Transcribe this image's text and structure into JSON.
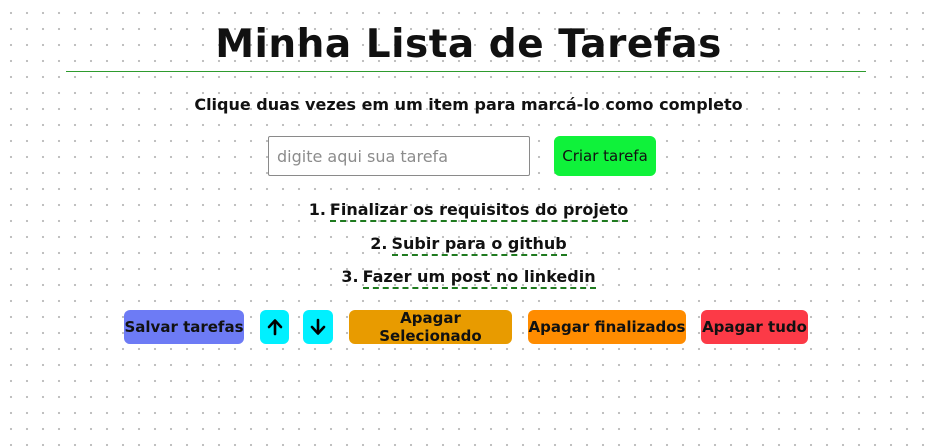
{
  "title": "Minha Lista de Tarefas",
  "subtitle": "Clique duas vezes em um item para marcá-lo como completo",
  "input": {
    "placeholder": "digite aqui sua tarefa",
    "value": ""
  },
  "create_button": "Criar tarefa",
  "tasks": [
    {
      "number": "1.",
      "text": "Finalizar os requisitos do projeto"
    },
    {
      "number": "2.",
      "text": "Subir para o github"
    },
    {
      "number": "3.",
      "text": "Fazer um post no linkedin"
    }
  ],
  "actions": {
    "save": "Salvar tarefas",
    "move_up_icon": "arrow-up-icon",
    "move_down_icon": "arrow-down-icon",
    "delete_selected": "Apagar Selecionado",
    "delete_finished": "Apagar finalizados",
    "delete_all": "Apagar tudo"
  },
  "colors": {
    "title_rule": "#2e9b2e",
    "create": "#0ff23a",
    "save": "#6d7bf5",
    "move": "#00f0ff",
    "delete_selected": "#e89b00",
    "delete_finished": "#ff8c00",
    "delete_all": "#fc3a47",
    "task_underline": "#1f7a1f"
  }
}
